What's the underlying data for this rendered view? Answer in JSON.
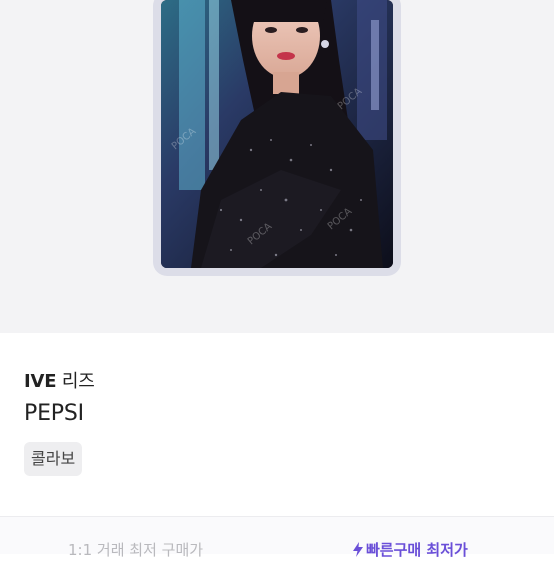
{
  "product": {
    "group": "IVE",
    "member": "리즈",
    "title": "PEPSI",
    "tag": "콜라보",
    "photo_watermark": "POCA"
  },
  "pricing": {
    "direct_trade_label": "1:1 거래 최저 구매가",
    "quick_buy_label": "빠른구매 최저가",
    "quick_buy_icon": "lightning-icon"
  },
  "colors": {
    "accent": "#6a4fd8",
    "hero_background": "#f3f3f5",
    "tag_background": "#eeeef0"
  }
}
